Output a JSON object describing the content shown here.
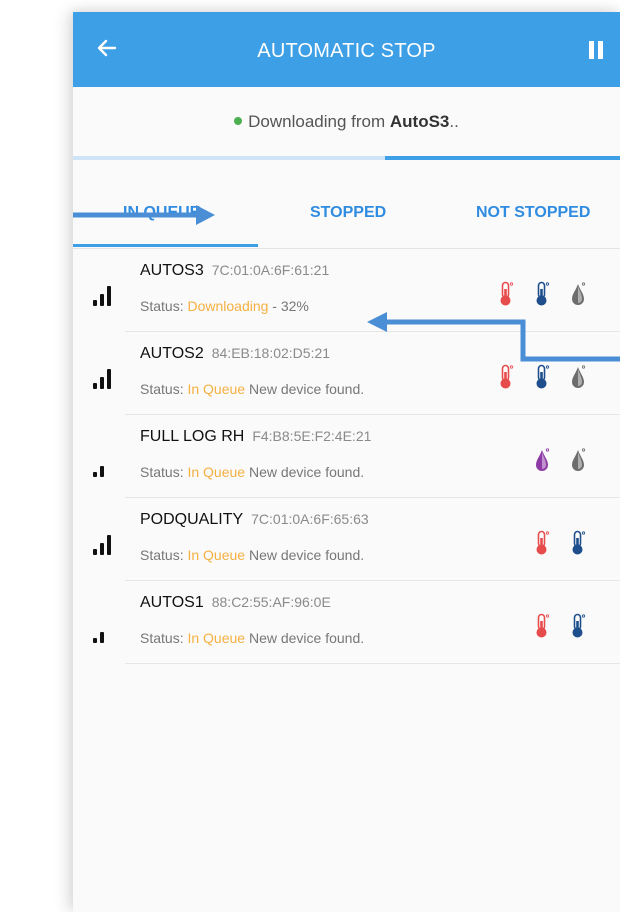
{
  "appbar": {
    "title": "AUTOMATIC STOP"
  },
  "status": {
    "prefix": "Downloading from ",
    "device": "AutoS3",
    "suffix": ".."
  },
  "progress": {
    "fraction": 0.43
  },
  "tabs": [
    {
      "label": "IN QUEUE",
      "active": true
    },
    {
      "label": "STOPPED",
      "active": false
    },
    {
      "label": "NOT STOPPED",
      "active": false
    }
  ],
  "devices": [
    {
      "name": "AUTOS3",
      "mac": "7C:01:0A:6F:61:21",
      "status_label": "Status: ",
      "state": "Downloading",
      "detail": " - 32%",
      "signal": 3,
      "icons": [
        "thermometer-red",
        "thermometer-blue",
        "drop-gray"
      ]
    },
    {
      "name": "AUTOS2",
      "mac": "84:EB:18:02:D5:21",
      "status_label": "Status: ",
      "state": "In Queue",
      "detail": " New device found.",
      "signal": 3,
      "icons": [
        "thermometer-red",
        "thermometer-blue",
        "drop-gray"
      ]
    },
    {
      "name": "FULL LOG RH",
      "mac": "F4:B8:5E:F2:4E:21",
      "status_label": "Status: ",
      "state": "In Queue",
      "detail": " New device found.",
      "signal": 2,
      "icons": [
        "drop-purple",
        "drop-gray"
      ]
    },
    {
      "name": "PODQUALITY",
      "mac": "7C:01:0A:6F:65:63",
      "status_label": "Status: ",
      "state": "In Queue",
      "detail": " New device found.",
      "signal": 3,
      "icons": [
        "thermometer-red",
        "thermometer-blue"
      ]
    },
    {
      "name": "AUTOS1",
      "mac": "88:C2:55:AF:96:0E",
      "status_label": "Status: ",
      "state": "In Queue",
      "detail": " New device found.",
      "signal": 2,
      "icons": [
        "thermometer-red",
        "thermometer-blue"
      ]
    }
  ],
  "colors": {
    "primary": "#3d9fe6",
    "state_text": "#f5b042",
    "dot": "#4caf50",
    "thermo_red": "#e74c4c",
    "thermo_blue": "#1e4f8c",
    "drop_gray": "#6d6d6d",
    "drop_purple": "#8e3aa6",
    "annotation_arrow": "#4a8fd6"
  }
}
